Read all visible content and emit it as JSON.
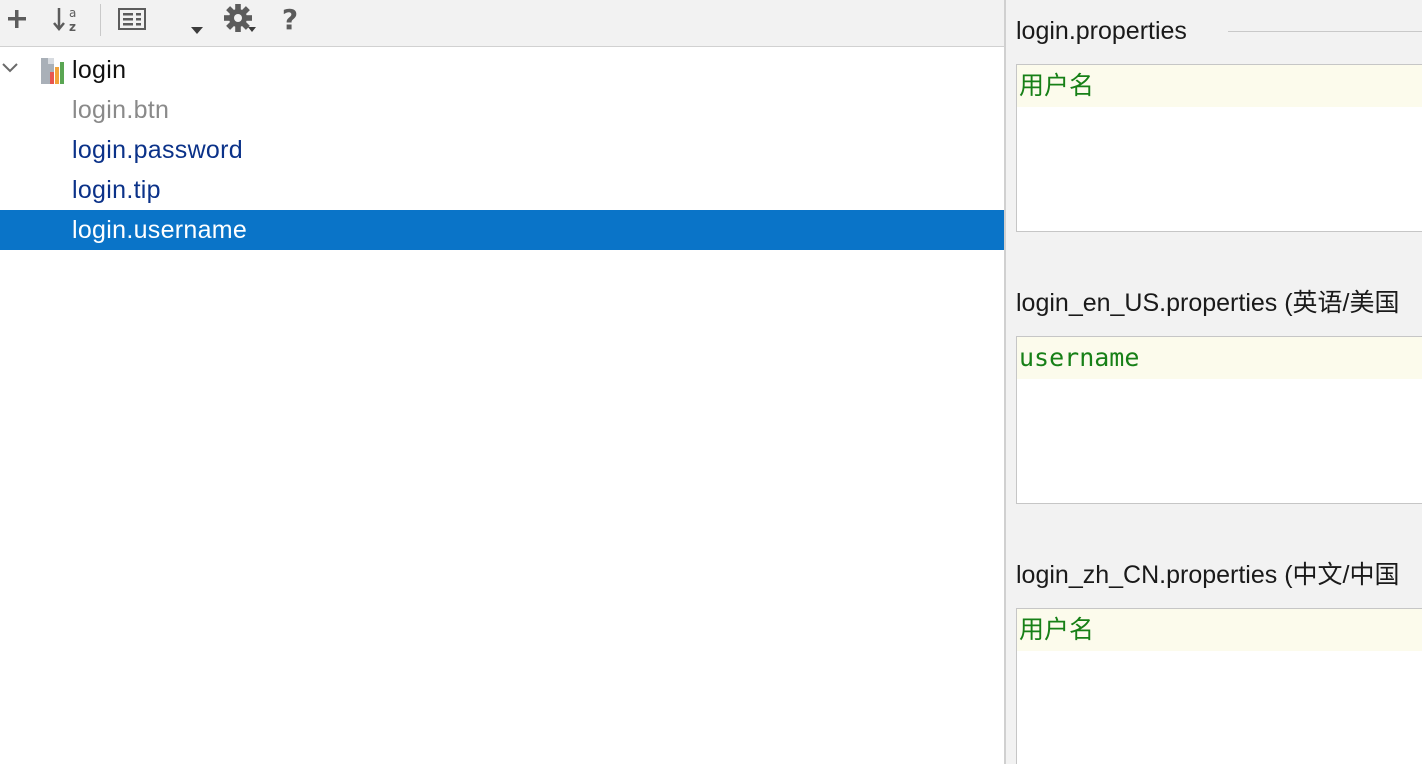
{
  "toolbar": {
    "buttons": [
      {
        "name": "add",
        "icon": "plus-icon"
      },
      {
        "name": "sort",
        "icon": "sort-alphabetically-icon"
      },
      {
        "name": "group",
        "icon": "group-by-icon"
      },
      {
        "name": "expand",
        "icon": "dropdown-arrow-icon"
      },
      {
        "name": "settings",
        "icon": "gear-icon"
      },
      {
        "name": "help",
        "icon": "question-icon",
        "glyph": "?"
      }
    ]
  },
  "tree": {
    "root": {
      "label": "login",
      "icon": "resource-bundle-icon",
      "expanded": true
    },
    "items": [
      {
        "label": "login.btn",
        "state": "unused",
        "color": "#8a8a8a"
      },
      {
        "label": "login.password",
        "state": "normal",
        "color": "#0b3289"
      },
      {
        "label": "login.tip",
        "state": "normal",
        "color": "#0b3289"
      },
      {
        "label": "login.username",
        "state": "selected",
        "color": "#ffffff"
      }
    ],
    "selection_color": "#0a74c8"
  },
  "editors": [
    {
      "file": "login.properties",
      "value": "用户名"
    },
    {
      "file": "login_en_US.properties (英语/美国",
      "value": "username"
    },
    {
      "file": "login_zh_CN.properties (中文/中国",
      "value": "用户名"
    }
  ],
  "colors": {
    "value_text": "#178017",
    "editor_line_highlight": "#fcfbec"
  }
}
